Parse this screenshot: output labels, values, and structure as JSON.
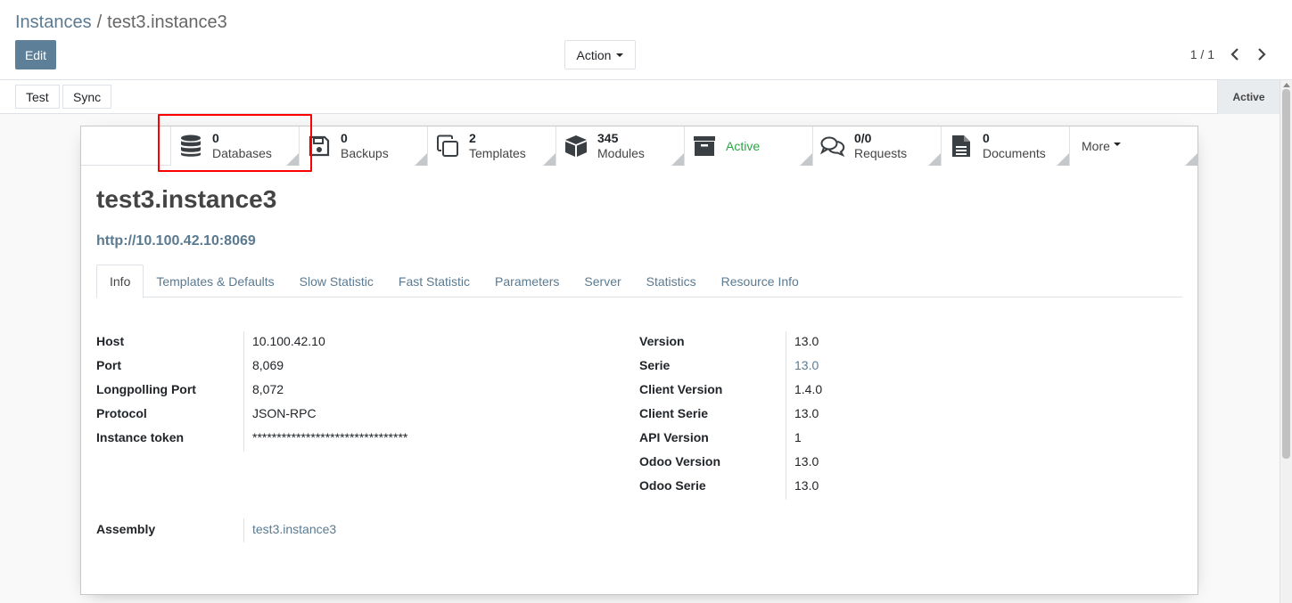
{
  "breadcrumb": {
    "parent": "Instances",
    "separator": "/",
    "current": "test3.instance3"
  },
  "toolbar": {
    "edit_label": "Edit",
    "action_label": "Action"
  },
  "pager": {
    "value": "1 / 1"
  },
  "statusbar": {
    "test_label": "Test",
    "sync_label": "Sync",
    "state_label": "Active"
  },
  "smart_buttons": [
    {
      "value": "0",
      "label": "Databases",
      "icon": "database-icon"
    },
    {
      "value": "0",
      "label": "Backups",
      "icon": "floppy-disk-icon"
    },
    {
      "value": "2",
      "label": "Templates",
      "icon": "copy-icon"
    },
    {
      "value": "345",
      "label": "Modules",
      "icon": "cube-icon"
    },
    {
      "value": "",
      "label": "Active",
      "icon": "archive-icon"
    },
    {
      "value": "0/0",
      "label": "Requests",
      "icon": "comments-icon"
    },
    {
      "value": "0",
      "label": "Documents",
      "icon": "document-icon"
    }
  ],
  "more_label": "More",
  "record": {
    "title": "test3.instance3",
    "url": "http://10.100.42.10:8069"
  },
  "tabs": [
    "Info",
    "Templates & Defaults",
    "Slow Statistic",
    "Fast Statistic",
    "Parameters",
    "Server",
    "Statistics",
    "Resource Info"
  ],
  "info_left": [
    {
      "label": "Host",
      "value": "10.100.42.10"
    },
    {
      "label": "Port",
      "value": "8,069"
    },
    {
      "label": "Longpolling Port",
      "value": "8,072"
    },
    {
      "label": "Protocol",
      "value": "JSON-RPC"
    },
    {
      "label": "Instance token",
      "value": "********************************"
    }
  ],
  "info_right": [
    {
      "label": "Version",
      "value": "13.0"
    },
    {
      "label": "Serie",
      "value": "13.0"
    },
    {
      "label": "Client Version",
      "value": "1.4.0"
    },
    {
      "label": "Client Serie",
      "value": "13.0"
    },
    {
      "label": "API Version",
      "value": "1"
    },
    {
      "label": "Odoo Version",
      "value": "13.0"
    },
    {
      "label": "Odoo Serie",
      "value": "13.0"
    }
  ],
  "assembly": {
    "label": "Assembly",
    "value": "test3.instance3"
  },
  "colors": {
    "link": "#5a7a91",
    "primary": "#5e7f98",
    "active_green": "#28a745",
    "highlight": "#ff0000"
  }
}
